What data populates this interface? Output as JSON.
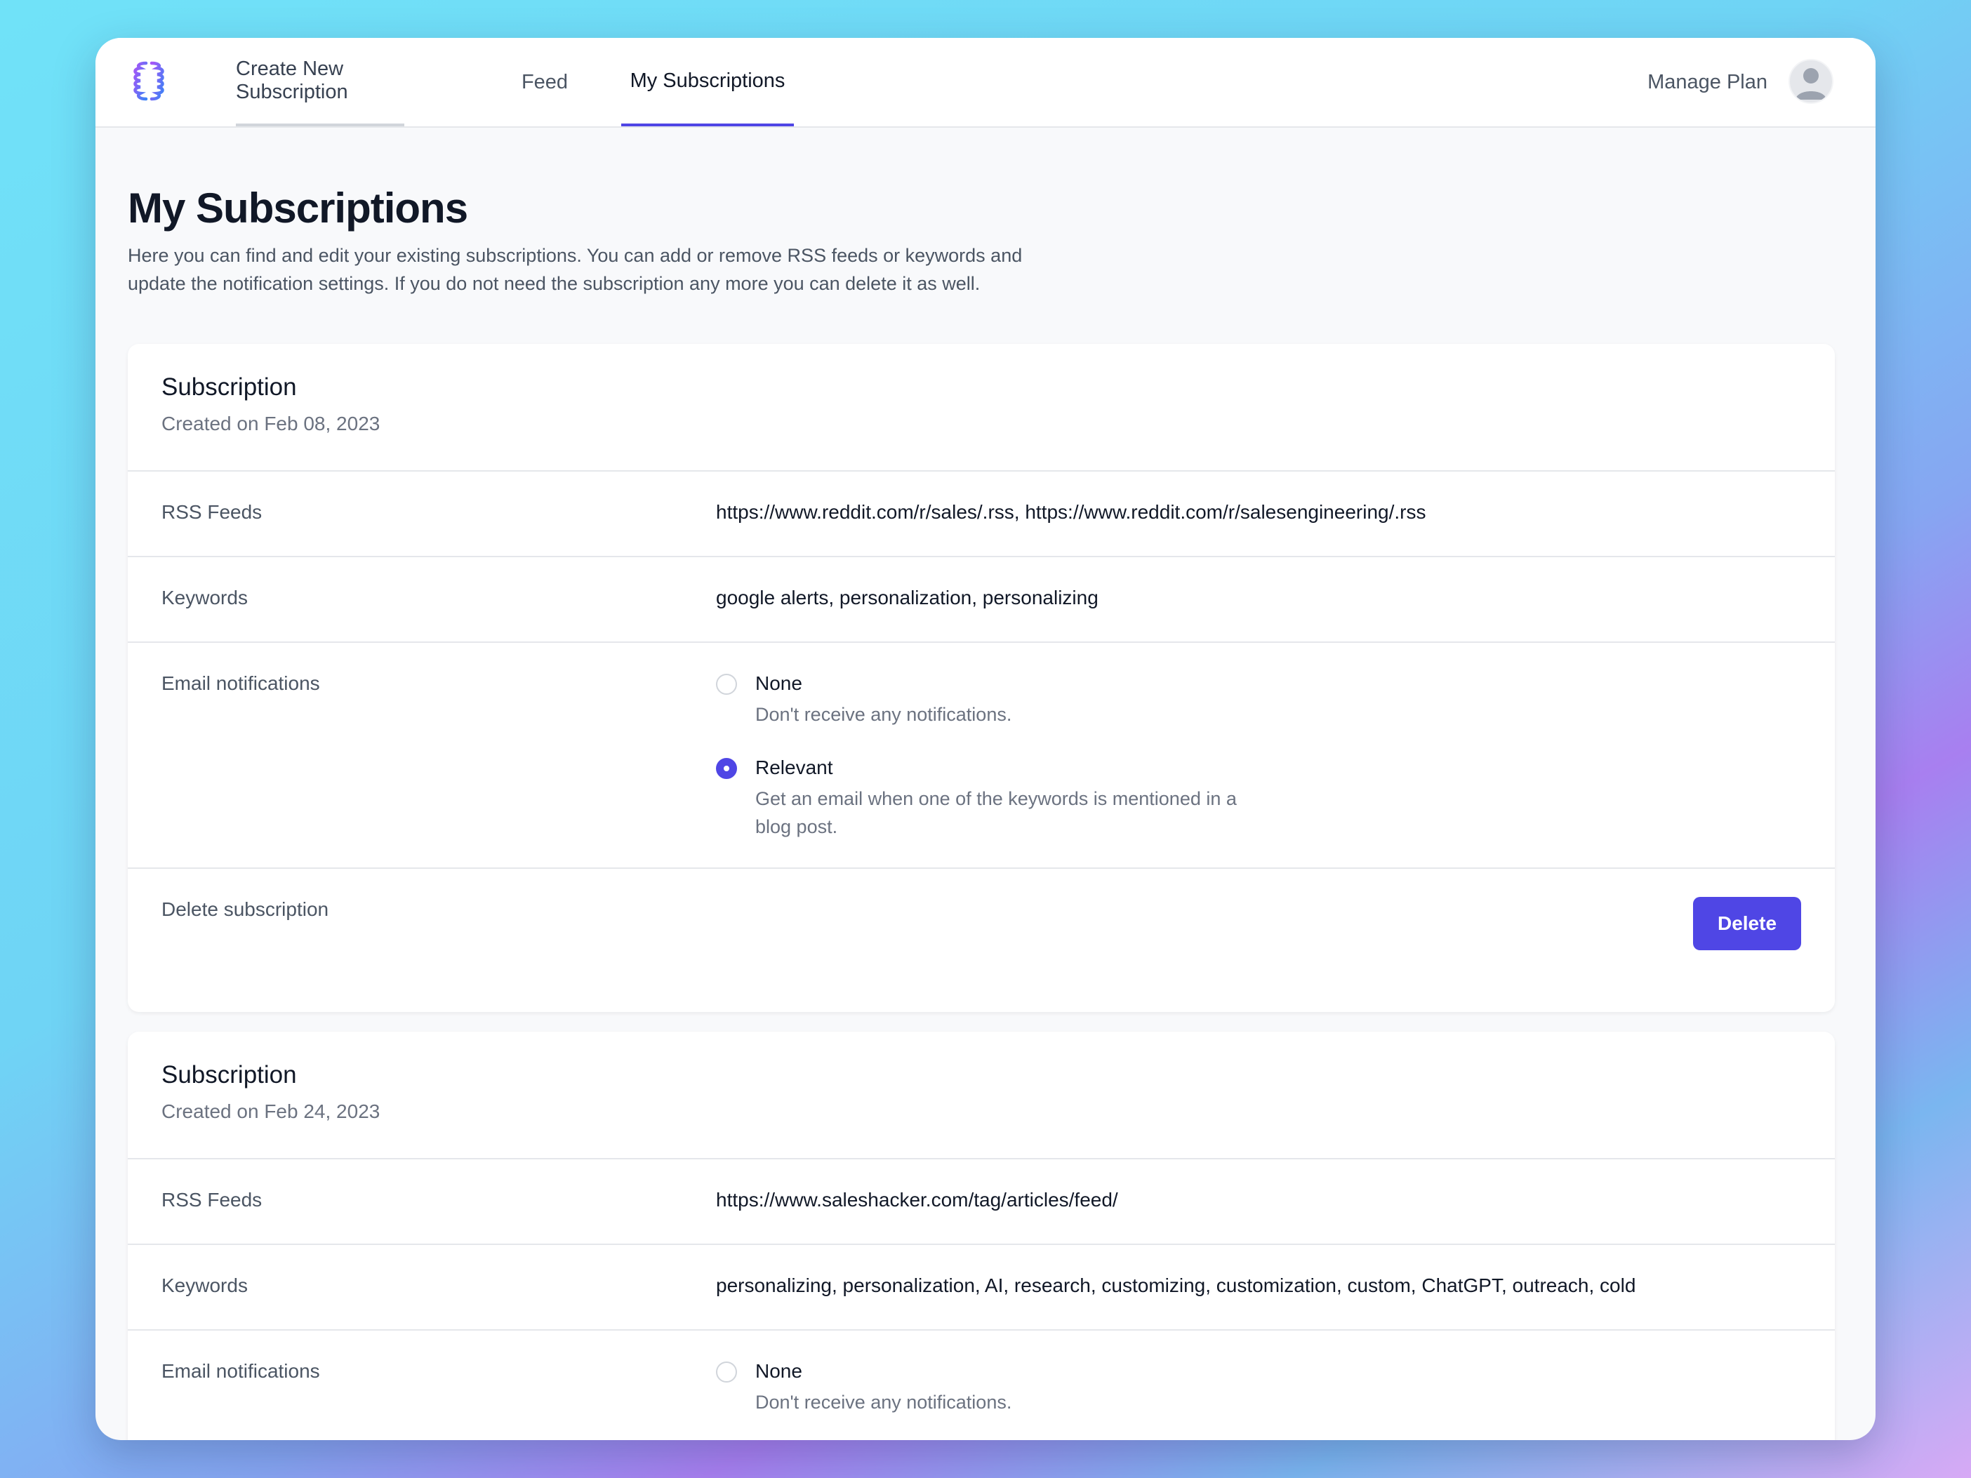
{
  "colors": {
    "accent": "#4f46e5",
    "text_primary": "#111827",
    "text_secondary": "#6b7280"
  },
  "nav": {
    "logo_icon": "brain-logo-icon",
    "tabs": [
      {
        "label": "Create New Subscription"
      },
      {
        "label": "Feed"
      },
      {
        "label": "My Subscriptions",
        "active": true
      }
    ],
    "manage_plan": "Manage Plan",
    "avatar_icon": "user-avatar-icon"
  },
  "page": {
    "title": "My Subscriptions",
    "description": "Here you can find and edit your existing subscriptions. You can add or remove RSS feeds or keywords and update the notification settings. If you do not need the subscription any more you can delete it as well."
  },
  "labels": {
    "rss_feeds": "RSS Feeds",
    "keywords": "Keywords",
    "email_notifications": "Email notifications",
    "delete_subscription": "Delete subscription",
    "delete_button": "Delete"
  },
  "subscriptions": [
    {
      "title": "Subscription",
      "created": "Created on Feb 08, 2023",
      "rss_feeds": "https://www.reddit.com/r/sales/.rss, https://www.reddit.com/r/salesengineering/.rss",
      "keywords": "google alerts, personalization, personalizing",
      "notification_options": [
        {
          "title": "None",
          "description": "Don't receive any notifications.",
          "selected": false
        },
        {
          "title": "Relevant",
          "description": "Get an email when one of the keywords is mentioned in a blog post.",
          "selected": true
        }
      ]
    },
    {
      "title": "Subscription",
      "created": "Created on Feb 24, 2023",
      "rss_feeds": "https://www.saleshacker.com/tag/articles/feed/",
      "keywords": "personalizing, personalization, AI, research, customizing, customization, custom, ChatGPT, outreach, cold",
      "notification_options": [
        {
          "title": "None",
          "description": "Don't receive any notifications.",
          "selected": false
        }
      ]
    }
  ]
}
